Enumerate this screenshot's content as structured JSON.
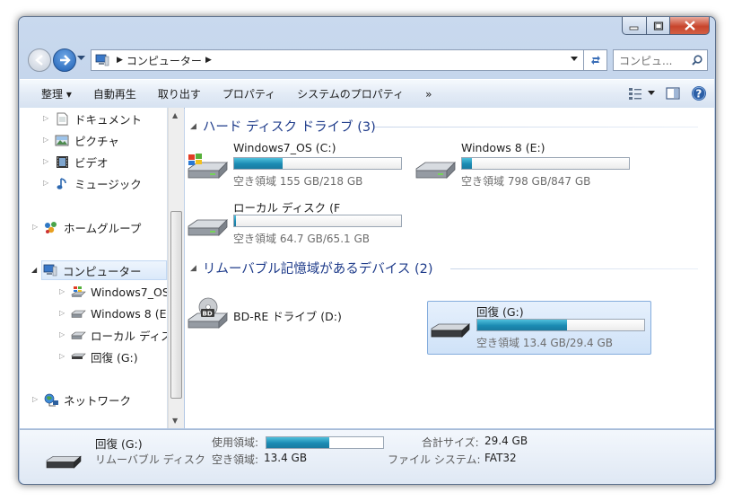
{
  "window": {
    "caption": {
      "minimize_icon": "minimize-icon",
      "maximize_icon": "maximize-icon",
      "close_icon": "close-icon"
    }
  },
  "addressbar": {
    "crumbs": [
      "コンピューター"
    ],
    "search_placeholder": "コンピュ...",
    "icons": [
      "back-arrow-icon",
      "forward-arrow-icon",
      "computer-icon",
      "refresh-icon",
      "search-icon"
    ]
  },
  "toolbar": {
    "organize": "整理 ▾",
    "autoplay": "自動再生",
    "eject": "取り出す",
    "properties": "プロパティ",
    "system_properties": "システムのプロパティ",
    "more": "»"
  },
  "nav": {
    "items": [
      {
        "label": "ドキュメント",
        "icon": "document-icon"
      },
      {
        "label": "ピクチャ",
        "icon": "picture-icon"
      },
      {
        "label": "ビデオ",
        "icon": "video-icon"
      },
      {
        "label": "ミュージック",
        "icon": "music-icon"
      },
      {
        "label": "ホームグループ",
        "icon": "homegroup-icon"
      },
      {
        "label": "コンピューター",
        "icon": "computer-icon"
      },
      {
        "label": "Windows7_OS (",
        "icon": "windows-drive-icon"
      },
      {
        "label": "Windows 8 (E:)",
        "icon": "drive-icon"
      },
      {
        "label": "ローカル ディス",
        "icon": "drive-icon"
      },
      {
        "label": "回復 (G:)",
        "icon": "usb-drive-icon"
      },
      {
        "label": "ネットワーク",
        "icon": "network-icon"
      }
    ]
  },
  "groups": {
    "hdd": {
      "title": "ハード ディスク ドライブ (3)"
    },
    "removable": {
      "title": "リムーバブル記憶域があるデバイス (2)"
    }
  },
  "drives": [
    {
      "name": "Windows7_OS (C:)",
      "free_text": "空き領域 155 GB/218 GB",
      "used_fraction": 0.29,
      "icon": "windows-drive-icon"
    },
    {
      "name": "Windows 8 (E:)",
      "free_text": "空き領域 798 GB/847 GB",
      "used_fraction": 0.06,
      "icon": "drive-icon"
    },
    {
      "name": "ローカル ディスク (F",
      "free_text": "空き領域 64.7 GB/65.1 GB",
      "used_fraction": 0.01,
      "icon": "drive-icon"
    },
    {
      "name": "BD-RE ドライブ (D:)",
      "icon": "bd-drive-icon"
    },
    {
      "name": "回復 (G:)",
      "free_text": "空き領域 13.4 GB/29.4 GB",
      "used_fraction": 0.54,
      "icon": "usb-drive-icon"
    }
  ],
  "details": {
    "name": "回復 (G:)",
    "type": "リムーバブル ディスク",
    "used_label": "使用領域:",
    "free_label": "空き領域:",
    "free_value": "13.4 GB",
    "total_label": "合計サイズ:",
    "total_value": "29.4 GB",
    "fs_label": "ファイル システム:",
    "fs_value": "FAT32",
    "used_fraction": 0.54
  },
  "colors": {
    "bar_fill": "#1b8bb3",
    "group_header": "#1e3b8a",
    "selection": "#cfe2f8"
  }
}
